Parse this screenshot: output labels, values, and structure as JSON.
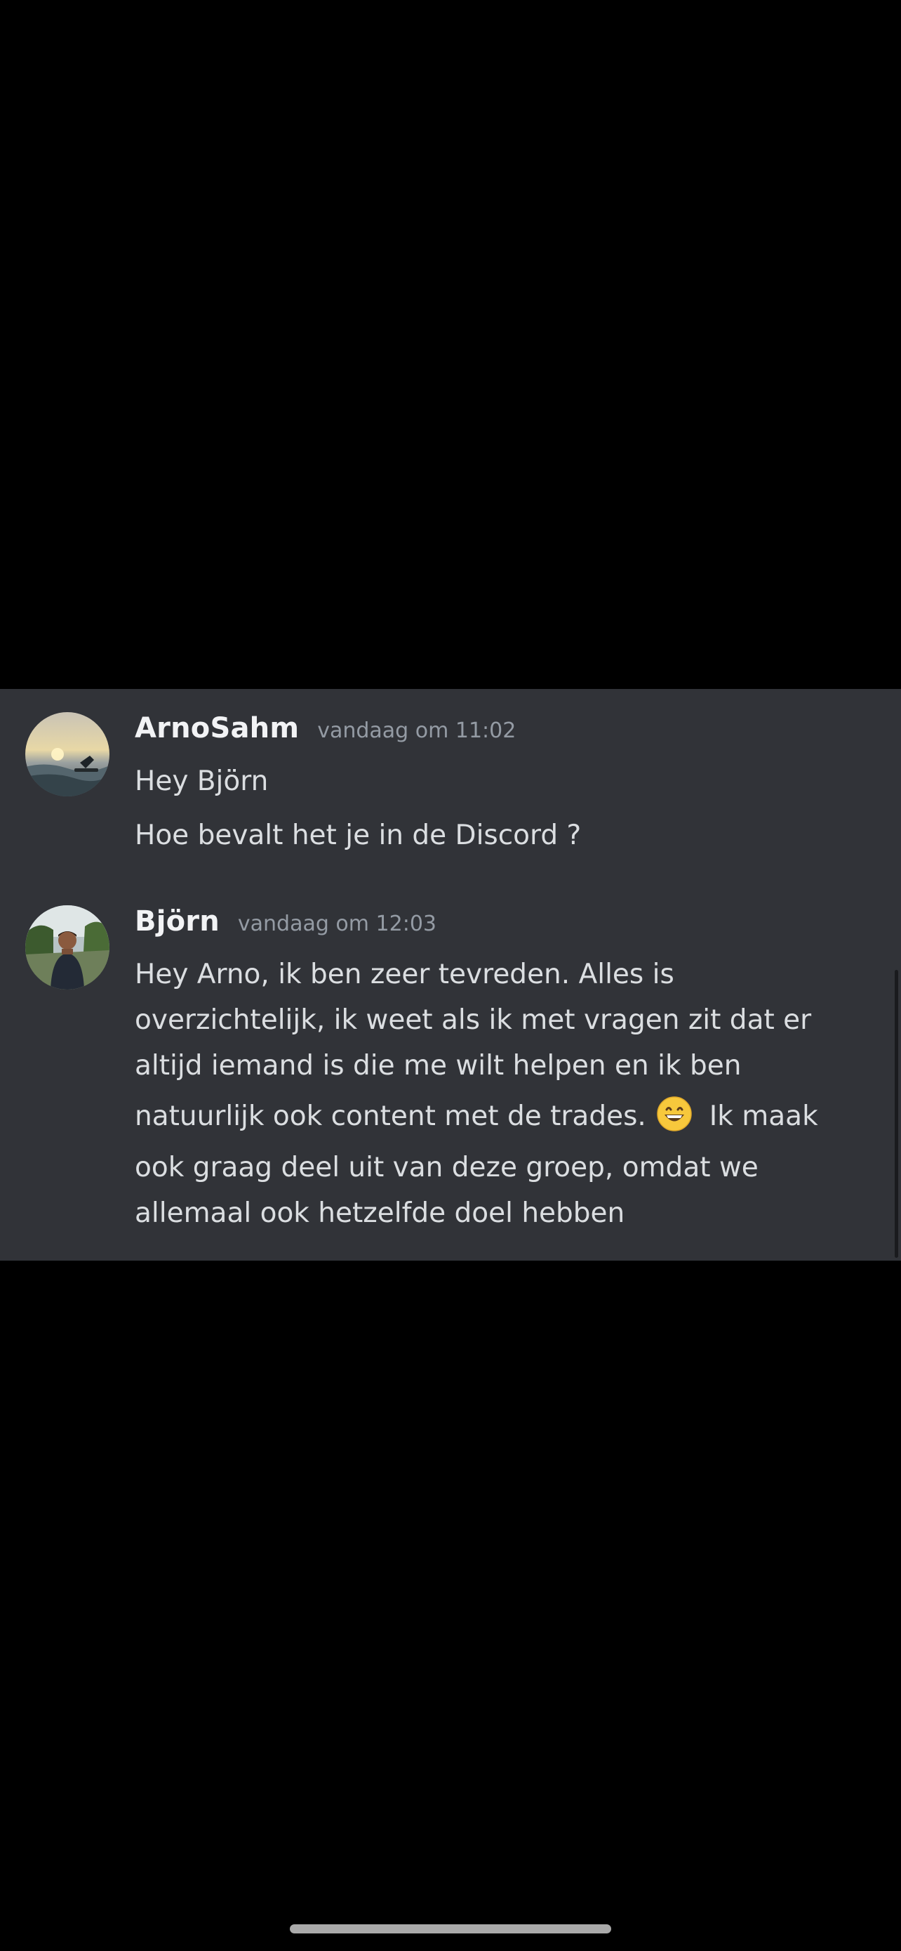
{
  "messages": [
    {
      "author": "ArnoSahm",
      "timestamp": "vandaag om 11:02",
      "avatar_icon": "avatar-sunset-surfer",
      "lines": [
        "Hey Björn",
        "Hoe bevalt het je in de Discord ?"
      ]
    },
    {
      "author": "Björn",
      "timestamp": "vandaag om 12:03",
      "avatar_icon": "avatar-man-outdoors",
      "lines": [
        "Hey Arno, ik ben zeer tevreden. Alles is",
        "overzichtelijk, ik weet als ik met vragen zit dat er",
        "altijd iemand is die me wilt helpen en ik ben",
        "natuurlijk ook content met de trades.",
        "Ik maak",
        "ook graag deel uit van deze groep, omdat we",
        "allemaal ook hetzelfde doel hebben"
      ],
      "emoji_icon": "grinning-face-emoji"
    }
  ],
  "colors": {
    "page_background": "#000000",
    "chat_background": "#313338",
    "username": "#f2f3f5",
    "timestamp": "#949ba4",
    "message_text": "#dbdee1"
  }
}
